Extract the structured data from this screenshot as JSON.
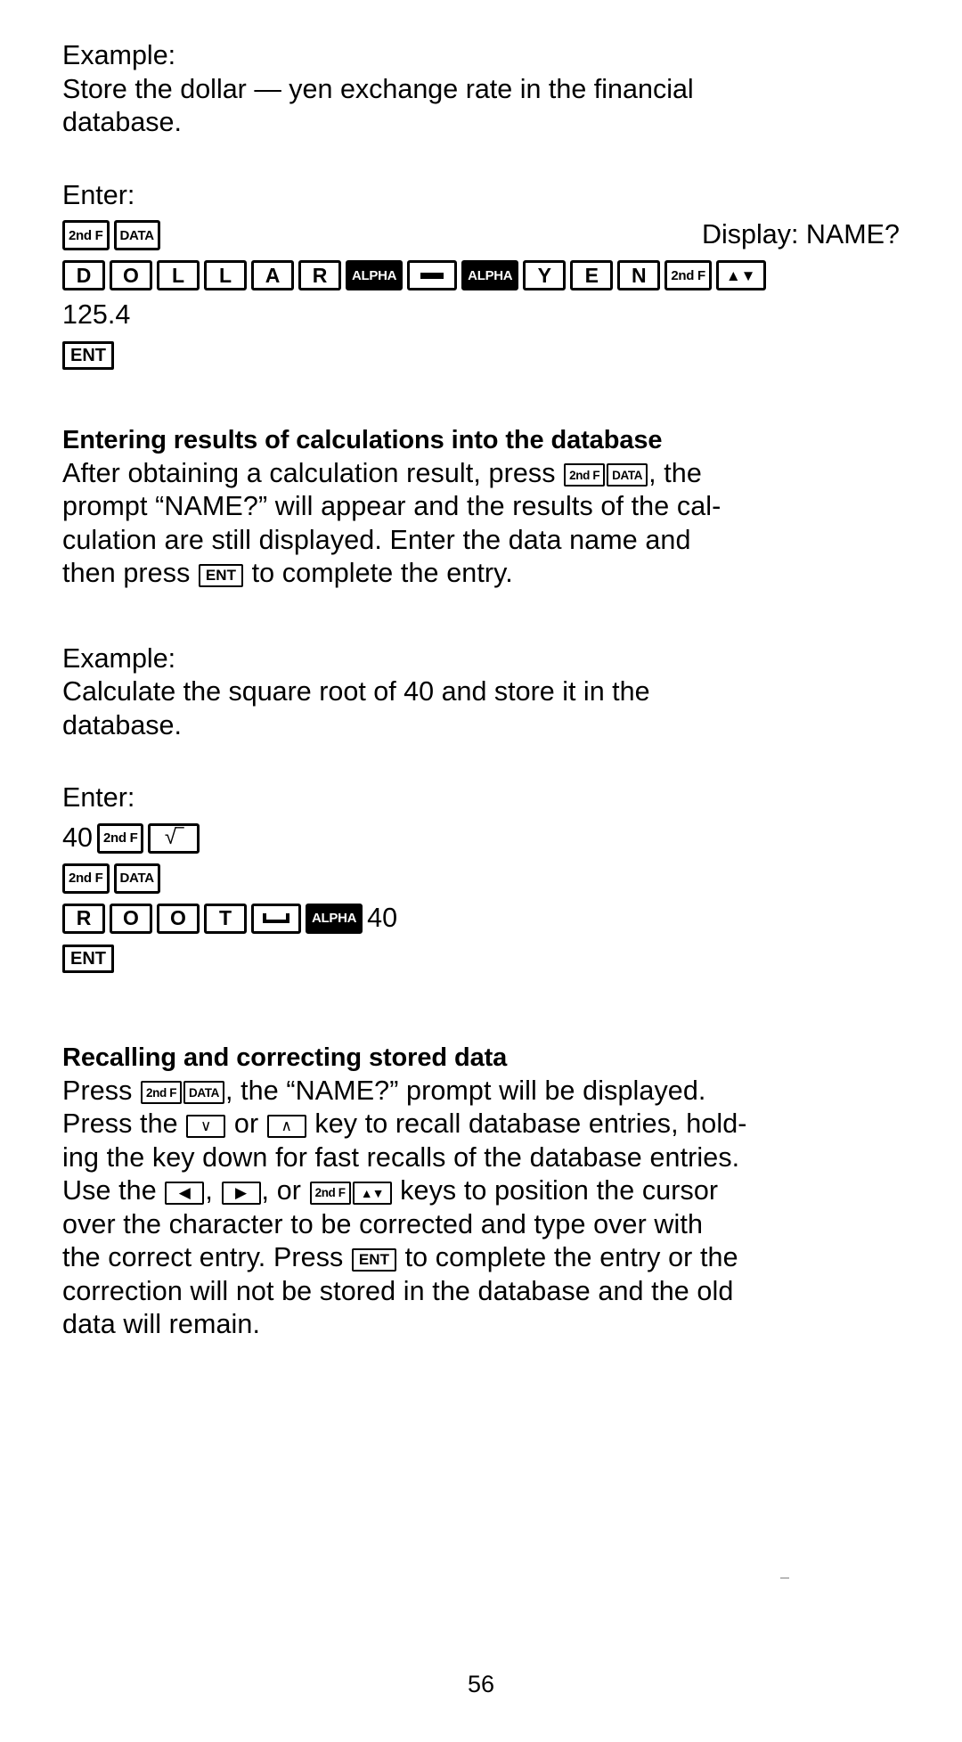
{
  "page": {
    "number": "56"
  },
  "sections": {
    "example1": {
      "label": "Example:",
      "body_line1": "Store the dollar — yen exchange rate in the financial",
      "body_line2": "database.",
      "enter_label": "Enter:",
      "display_note": "Display: NAME?",
      "keys_row1": [
        {
          "label": "2nd F",
          "style": "outline",
          "size": "small-text"
        },
        {
          "label": "DATA",
          "style": "outline",
          "size": "small-text"
        }
      ],
      "keys_row2": [
        {
          "label": "D",
          "style": "outline",
          "size": "normal"
        },
        {
          "label": "O",
          "style": "outline",
          "size": "normal"
        },
        {
          "label": "L",
          "style": "outline",
          "size": "normal"
        },
        {
          "label": "L",
          "style": "outline",
          "size": "normal"
        },
        {
          "label": "A",
          "style": "outline",
          "size": "normal"
        },
        {
          "label": "R",
          "style": "outline",
          "size": "normal"
        },
        {
          "label": "ALPHA",
          "style": "filled",
          "size": "small-text"
        },
        {
          "label": "—",
          "style": "outline",
          "size": "normal",
          "glyph": "minus"
        },
        {
          "label": "ALPHA",
          "style": "filled",
          "size": "small-text"
        },
        {
          "label": "Y",
          "style": "outline",
          "size": "normal"
        },
        {
          "label": "E",
          "style": "outline",
          "size": "normal"
        },
        {
          "label": "N",
          "style": "outline",
          "size": "normal"
        },
        {
          "label": "2nd F",
          "style": "outline",
          "size": "small-text"
        },
        {
          "label": "▲▼",
          "style": "outline",
          "size": "normal",
          "glyph": "updown"
        }
      ],
      "value": "125.4",
      "enter_key": "ENT"
    },
    "calc_results": {
      "heading": "Entering results of calculations into the database",
      "line1_pre": "After obtaining a calculation result, press ",
      "line1_key1": "2nd F",
      "line1_key2": "DATA",
      "line1_post": ", the",
      "line2": "prompt “NAME?” will appear and the results of the cal-",
      "line3": "culation are still displayed. Enter the data name and",
      "line4_pre": "then press ",
      "line4_key": "ENT",
      "line4_post": " to complete the entry."
    },
    "example2": {
      "label": "Example:",
      "body_line1": "Calculate the square root of 40 and store it in the",
      "body_line2": "database.",
      "enter_label": "Enter:",
      "row1_value": "40",
      "row1_keys": [
        {
          "label": "2nd F",
          "style": "outline",
          "size": "small-text"
        },
        {
          "label": "√‾",
          "style": "outline",
          "size": "sqrt",
          "glyph": "sqrt"
        }
      ],
      "row2_keys": [
        {
          "label": "2nd F",
          "style": "outline",
          "size": "small-text"
        },
        {
          "label": "DATA",
          "style": "outline",
          "size": "small-text"
        }
      ],
      "row3_keys": [
        {
          "label": "R",
          "style": "outline",
          "size": "normal"
        },
        {
          "label": "O",
          "style": "outline",
          "size": "normal"
        },
        {
          "label": "O",
          "style": "outline",
          "size": "normal"
        },
        {
          "label": "T",
          "style": "outline",
          "size": "normal"
        },
        {
          "label": "␣",
          "style": "outline",
          "size": "normal",
          "glyph": "space"
        },
        {
          "label": "ALPHA",
          "style": "filled",
          "size": "small-text"
        }
      ],
      "row3_trailing_value": "40",
      "enter_key": "ENT"
    },
    "recalling": {
      "heading": "Recalling and correcting stored data",
      "line1_pre": "Press ",
      "line1_key1": "2nd F",
      "line1_key2": "DATA",
      "line1_post": ", the “NAME?” prompt will be displayed.",
      "line2_pre": "Press the ",
      "line2_key1": "∨",
      "line2_mid": " or ",
      "line2_key2": "∧",
      "line2_post": " key to recall database entries, hold-",
      "line3": "ing the key down for fast recalls of the database entries.",
      "line4_pre": "Use the ",
      "line4_key1": "◀",
      "line4_sep1": ", ",
      "line4_key2": "▶",
      "line4_sep2": ", or ",
      "line4_key3": "2nd F",
      "line4_key4": "▲▼",
      "line4_post": " keys to position the cursor",
      "line5": "over the character to be corrected and type over with",
      "line6_pre": "the correct entry. Press ",
      "line6_key": "ENT",
      "line6_post": " to complete the entry or the",
      "line7": "correction will not be stored in the database and the old",
      "line8": "data will remain."
    }
  },
  "colors": {
    "ink": "#000000",
    "paper": "#ffffff"
  }
}
